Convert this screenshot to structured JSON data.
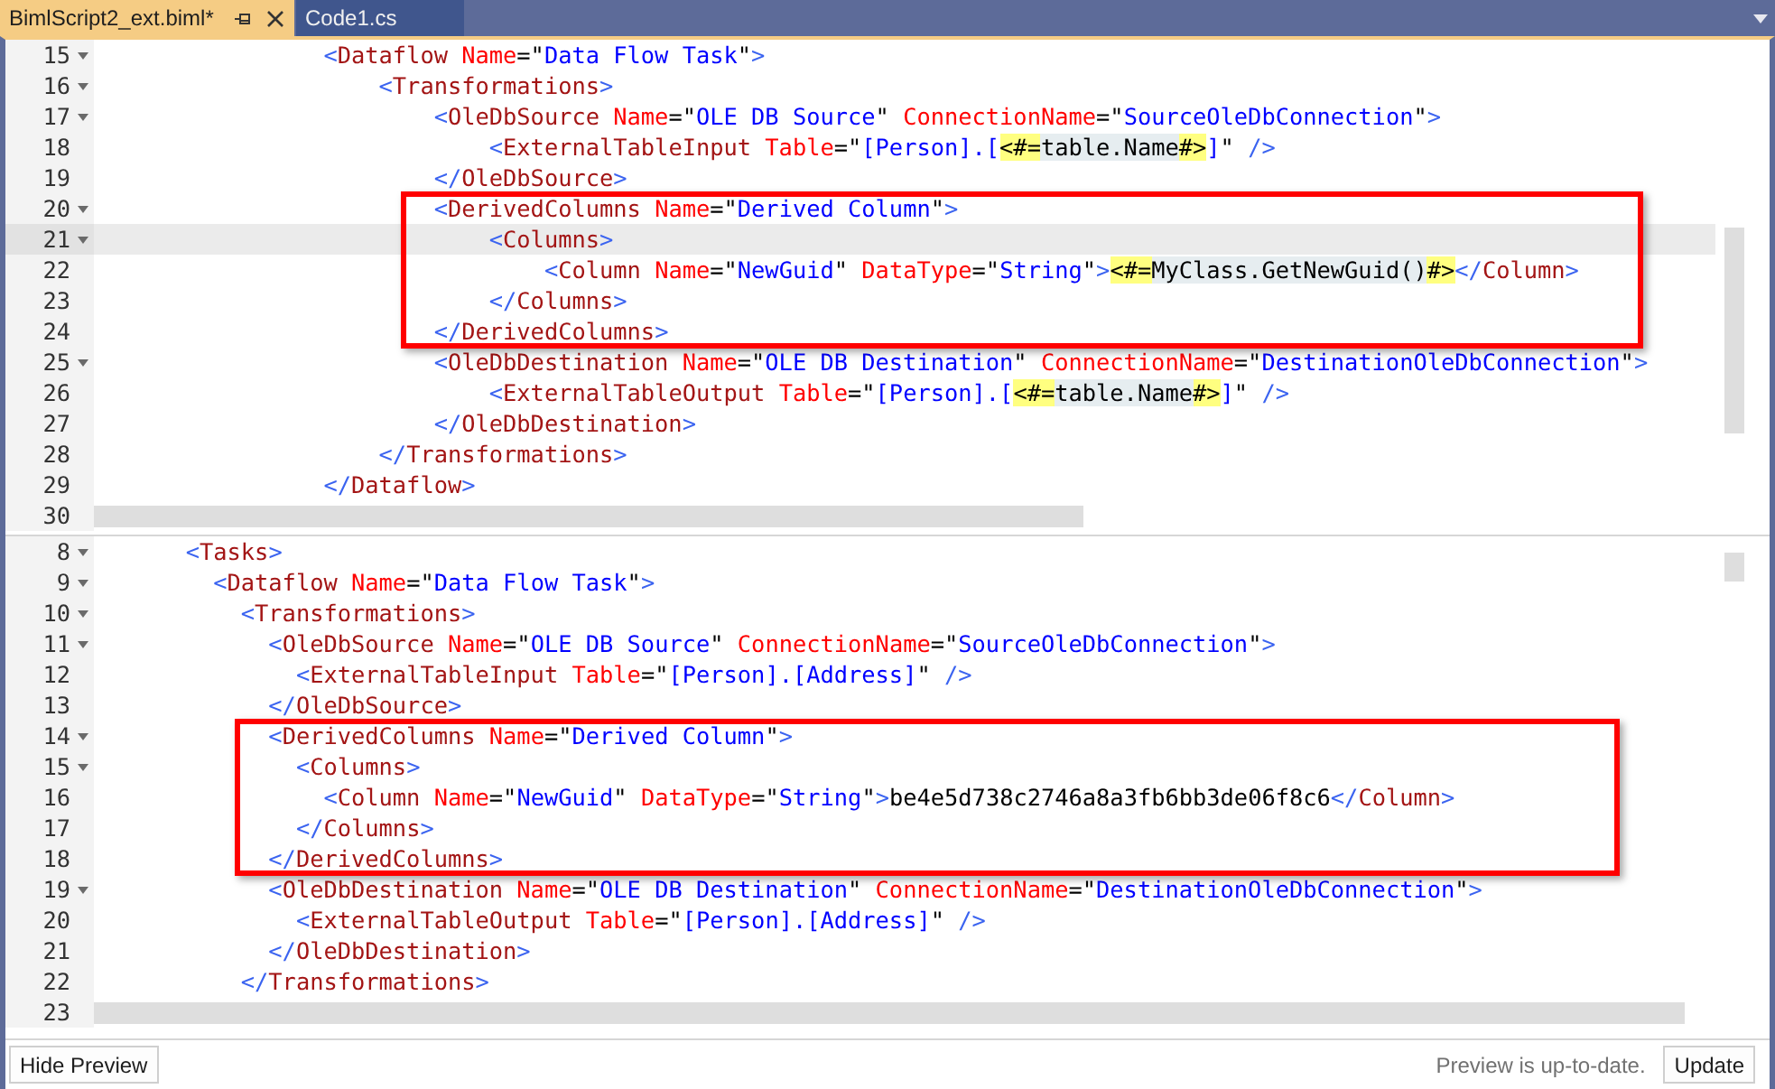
{
  "tabs": [
    {
      "label": "BimlScript2_ext.biml*",
      "selected": true
    },
    {
      "label": "Code1.cs",
      "selected": false
    }
  ],
  "panes": [
    {
      "blocks": [
        {
          "kind": "plain",
          "lines": [
            {
              "number": "15",
              "foldable": true,
              "current": false,
              "code": "                <Dataflow Name=\"Data Flow Task\">"
            },
            {
              "number": "16",
              "foldable": true,
              "current": false,
              "code": "                    <Transformations>"
            },
            {
              "number": "17",
              "foldable": true,
              "current": false,
              "code": "                        <OleDbSource Name=\"OLE DB Source\" ConnectionName=\"SourceOleDbConnection\">"
            },
            {
              "number": "18",
              "foldable": false,
              "current": false,
              "code": "                            <ExternalTableInput Table=\"[Person].[<#=table.Name#>]\" />"
            },
            {
              "number": "19",
              "foldable": false,
              "current": false,
              "code": "                        </OleDbSource>"
            }
          ]
        },
        {
          "kind": "framed",
          "lines": [
            {
              "number": "20",
              "foldable": true,
              "current": false,
              "code": "                        <DerivedColumns Name=\"Derived Column\">"
            },
            {
              "number": "21",
              "foldable": true,
              "current": true,
              "code": "                            <Columns>"
            },
            {
              "number": "22",
              "foldable": false,
              "current": false,
              "code": "                                <Column Name=\"NewGuid\" DataType=\"String\"><#=MyClass.GetNewGuid()#></Column>"
            },
            {
              "number": "23",
              "foldable": false,
              "current": false,
              "code": "                            </Columns>"
            },
            {
              "number": "24",
              "foldable": false,
              "current": false,
              "code": "                        </DerivedColumns>"
            }
          ]
        },
        {
          "kind": "plain",
          "lines": [
            {
              "number": "25",
              "foldable": true,
              "current": false,
              "code": "                        <OleDbDestination Name=\"OLE DB Destination\" ConnectionName=\"DestinationOleDbConnection\">"
            },
            {
              "number": "26",
              "foldable": false,
              "current": false,
              "code": "                            <ExternalTableOutput Table=\"[Person].[<#=table.Name#>]\" />"
            },
            {
              "number": "27",
              "foldable": false,
              "current": false,
              "code": "                        </OleDbDestination>"
            },
            {
              "number": "28",
              "foldable": false,
              "current": false,
              "code": "                    </Transformations>"
            },
            {
              "number": "29",
              "foldable": false,
              "current": false,
              "code": "                </Dataflow>"
            }
          ]
        }
      ],
      "scroll_row_number": "30"
    },
    {
      "blocks": [
        {
          "kind": "plain",
          "lines": [
            {
              "number": "8",
              "foldable": true,
              "current": false,
              "code": "      <Tasks>"
            },
            {
              "number": "9",
              "foldable": true,
              "current": false,
              "code": "        <Dataflow Name=\"Data Flow Task\">"
            },
            {
              "number": "10",
              "foldable": true,
              "current": false,
              "code": "          <Transformations>"
            },
            {
              "number": "11",
              "foldable": true,
              "current": false,
              "code": "            <OleDbSource Name=\"OLE DB Source\" ConnectionName=\"SourceOleDbConnection\">"
            },
            {
              "number": "12",
              "foldable": false,
              "current": false,
              "code": "              <ExternalTableInput Table=\"[Person].[Address]\" />"
            },
            {
              "number": "13",
              "foldable": false,
              "current": false,
              "code": "            </OleDbSource>"
            }
          ]
        },
        {
          "kind": "framed",
          "lines": [
            {
              "number": "14",
              "foldable": true,
              "current": false,
              "code": "            <DerivedColumns Name=\"Derived Column\">"
            },
            {
              "number": "15",
              "foldable": true,
              "current": false,
              "code": "              <Columns>"
            },
            {
              "number": "16",
              "foldable": false,
              "current": false,
              "code": "                <Column Name=\"NewGuid\" DataType=\"String\">be4e5d738c2746a8a3fb6bb3de06f8c6</Column>"
            },
            {
              "number": "17",
              "foldable": false,
              "current": false,
              "code": "              </Columns>"
            },
            {
              "number": "18",
              "foldable": false,
              "current": false,
              "code": "            </DerivedColumns>"
            }
          ]
        },
        {
          "kind": "plain",
          "lines": [
            {
              "number": "19",
              "foldable": true,
              "current": false,
              "code": "            <OleDbDestination Name=\"OLE DB Destination\" ConnectionName=\"DestinationOleDbConnection\">"
            },
            {
              "number": "20",
              "foldable": false,
              "current": false,
              "code": "              <ExternalTableOutput Table=\"[Person].[Address]\" />"
            },
            {
              "number": "21",
              "foldable": false,
              "current": false,
              "code": "            </OleDbDestination>"
            },
            {
              "number": "22",
              "foldable": false,
              "current": false,
              "code": "          </Transformations>"
            }
          ]
        }
      ],
      "scroll_row_number": "23"
    }
  ],
  "footer": {
    "hide_button": "Hide Preview",
    "status": "Preview is up-to-date.",
    "update_button": "Update"
  }
}
